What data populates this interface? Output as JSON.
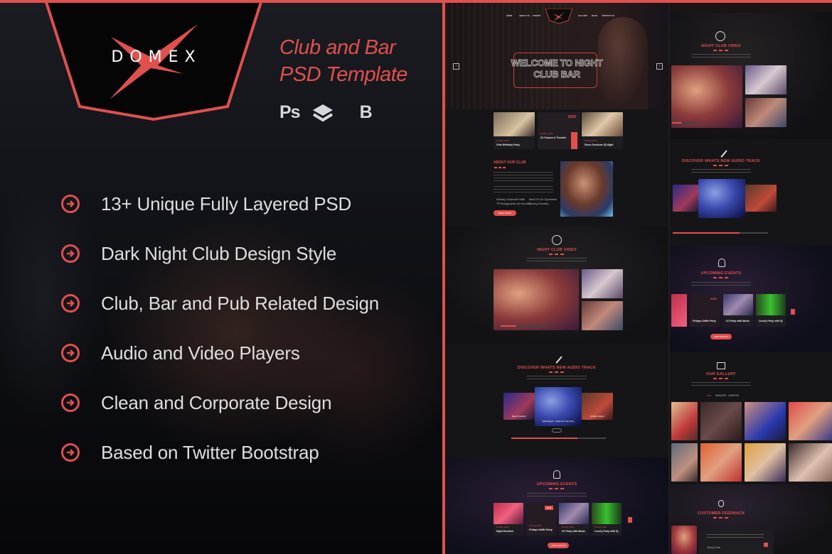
{
  "brand": {
    "logo_text": "DOMEX",
    "accent_color": "#e0504e",
    "title_line1": "Club and Bar",
    "title_line2": "PSD Template"
  },
  "tools": {
    "photoshop": "Ps",
    "layers_icon": "layers-icon",
    "bootstrap": "B"
  },
  "features": [
    {
      "label": "13+ Unique Fully Layered PSD"
    },
    {
      "label": "Dark Night Club Design Style"
    },
    {
      "label": "Club, Bar and Pub Related Design"
    },
    {
      "label": "Audio and Video Players"
    },
    {
      "label": "Clean and Corporate Design"
    },
    {
      "label": "Based on Twitter Bootstrap"
    }
  ],
  "preview": {
    "nav": [
      "HOME",
      "ABOUT US",
      "EVENTS",
      "GALLERY",
      "BLOG",
      "CONTACT US"
    ],
    "hero_title_line1": "WELCOME TO NIGHT",
    "hero_title_line2": "CLUB BAR",
    "hero_prev": "‹",
    "hero_next": "›",
    "event_price": "$350",
    "events_top": [
      {
        "date": "20 May 2018",
        "name": "Girls Birthday Party"
      },
      {
        "date": "20 May 2018",
        "name": "DJ Season & Thunder"
      },
      {
        "date": "20 May 2018",
        "name": "Disco Sessions Dj Night"
      }
    ],
    "about": {
      "title": "ABOUT OUR CLUB",
      "features": [
        "Weekly Schedule With",
        "Best DJ On Synthesis",
        "TP Bodyguards for security",
        "Strong Security"
      ],
      "button": "READ MORE"
    },
    "video": {
      "title": "NIGHT CLUB VIDEO",
      "progress": 0.35
    },
    "audio": {
      "title": "DISCOVER WHATS NEW AUDIO TRACK",
      "tracks": [
        "Beach Session",
        "Jalia Megan - Shape for Jammery",
        "Robbie Sagrat"
      ],
      "progress": 0.7
    },
    "upcoming": {
      "title": "UPCOMING EVENTS",
      "price": "$350",
      "events": [
        {
          "date": "20 May 2018",
          "name": "Night Emotion"
        },
        {
          "date": "20 May 2018",
          "name": "Fridays Saffle Party"
        },
        {
          "date": "20 May 2018",
          "name": "DJ Party with Music"
        },
        {
          "date": "20 May 2018",
          "name": "Lonely Party with Dj"
        }
      ],
      "button": "VIEW EVENTS"
    },
    "gallery": {
      "title": "OUR GALLERY",
      "filters": [
        "ALL",
        "IMAGES",
        "VIDEOS"
      ]
    },
    "feedback": {
      "title": "CUSTOMER FEEDBACK",
      "author": "Jenny Doe"
    }
  }
}
